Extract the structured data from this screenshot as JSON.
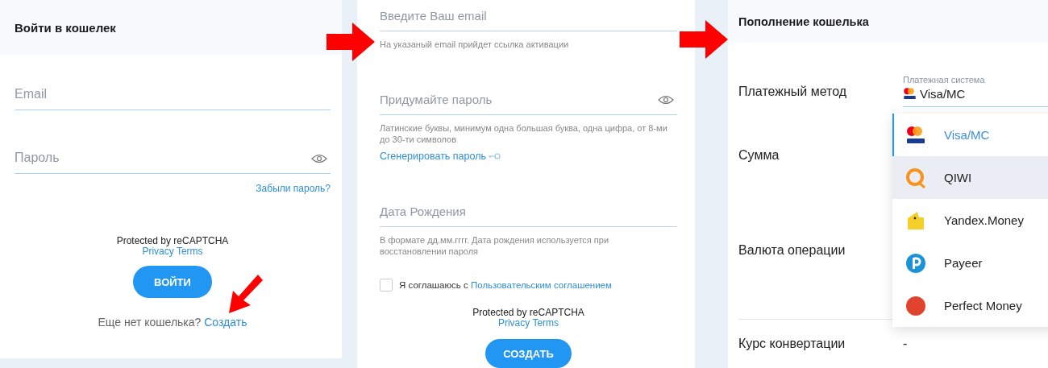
{
  "login": {
    "title": "Войти в кошелек",
    "fields": [
      {
        "placeholder": "Email",
        "kind": "text"
      },
      {
        "placeholder": "Пароль",
        "kind": "password"
      }
    ],
    "forgot_link": "Забыли пароль?",
    "recaptcha": {
      "text": "Protected by reCAPTCHA",
      "links": "Privacy Terms"
    },
    "submit_button": "ВОЙТИ",
    "signup_prompt": {
      "text": "Еще нет кошелька?",
      "link": "Создать"
    }
  },
  "register": {
    "fields": [
      {
        "placeholder": "Введите Ваш email",
        "kind": "text",
        "hint": "На указаный email прийдет ссылка активации"
      },
      {
        "placeholder": "Придумайте пароль",
        "kind": "password",
        "hint": "Латинские буквы, минимум одна большая буква, одна цифра, от 8-ми до 30-ти символов",
        "link": "Сгенерировать пароль"
      },
      {
        "placeholder": "Дата Рождения",
        "kind": "text",
        "hint": "В формате дд.мм.гггг. Дата рождения используется при восстановлении пароля"
      }
    ],
    "agreement": {
      "checked": false,
      "text": "Я соглашаюсь с",
      "link": "Пользовательским соглашением"
    },
    "recaptcha": {
      "text": "Protected by reCAPTCHA",
      "links": "Privacy Terms"
    },
    "submit_button": "СОЗДАТЬ"
  },
  "topup": {
    "title": "Пополнение кошелька",
    "payment_method": {
      "label": "Платежный метод",
      "select_label": "Платежная система",
      "value": "Visa/MC"
    },
    "amount_label": "Сумма",
    "currency_label": "Валюта операции",
    "rate": {
      "label": "Курс конвертации",
      "value": "-"
    },
    "dropdown": [
      {
        "label": "Visa/MC",
        "kind": "visa-mc",
        "selected": true,
        "highlighted": false
      },
      {
        "label": "QIWI",
        "kind": "qiwi",
        "selected": false,
        "highlighted": true
      },
      {
        "label": "Yandex.Money",
        "kind": "yandex",
        "selected": false,
        "highlighted": false
      },
      {
        "label": "Payeer",
        "kind": "payeer",
        "selected": false,
        "highlighted": false
      },
      {
        "label": "Perfect Money",
        "kind": "perfect",
        "selected": false,
        "highlighted": false
      }
    ]
  }
}
